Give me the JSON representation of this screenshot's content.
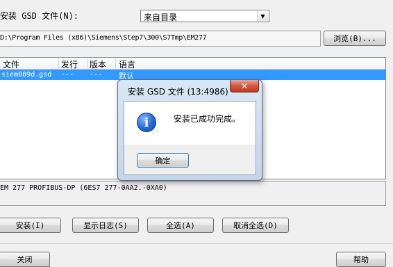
{
  "top": {
    "install_label": "安装 GSD 文件(N):",
    "source_selected": "来自目录",
    "path": "D:\\Program Files (x86)\\Siemens\\Step7\\300\\S7Tmp\\EM277",
    "browse_label": "浏览(B)..."
  },
  "list": {
    "columns": [
      "文件",
      "发行",
      "版本",
      "语言"
    ],
    "rows": [
      {
        "file": "siem089d.gsd",
        "release": "---",
        "version": "---",
        "language": "默认"
      }
    ]
  },
  "description": "EM 277 PROFIBUS-DP (6ES7 277-0AA2.-0XA0)",
  "buttons": {
    "install": "安装(I)",
    "show_log": "显示日志(S)",
    "select_all": "全选(A)",
    "deselect_all": "取消全选(D)",
    "close": "关闭",
    "help": "帮助"
  },
  "dialog": {
    "title": "安装 GSD 文件 (13:4986)",
    "message": "安装已成功完成。",
    "ok": "确定",
    "icon": "info-icon"
  }
}
